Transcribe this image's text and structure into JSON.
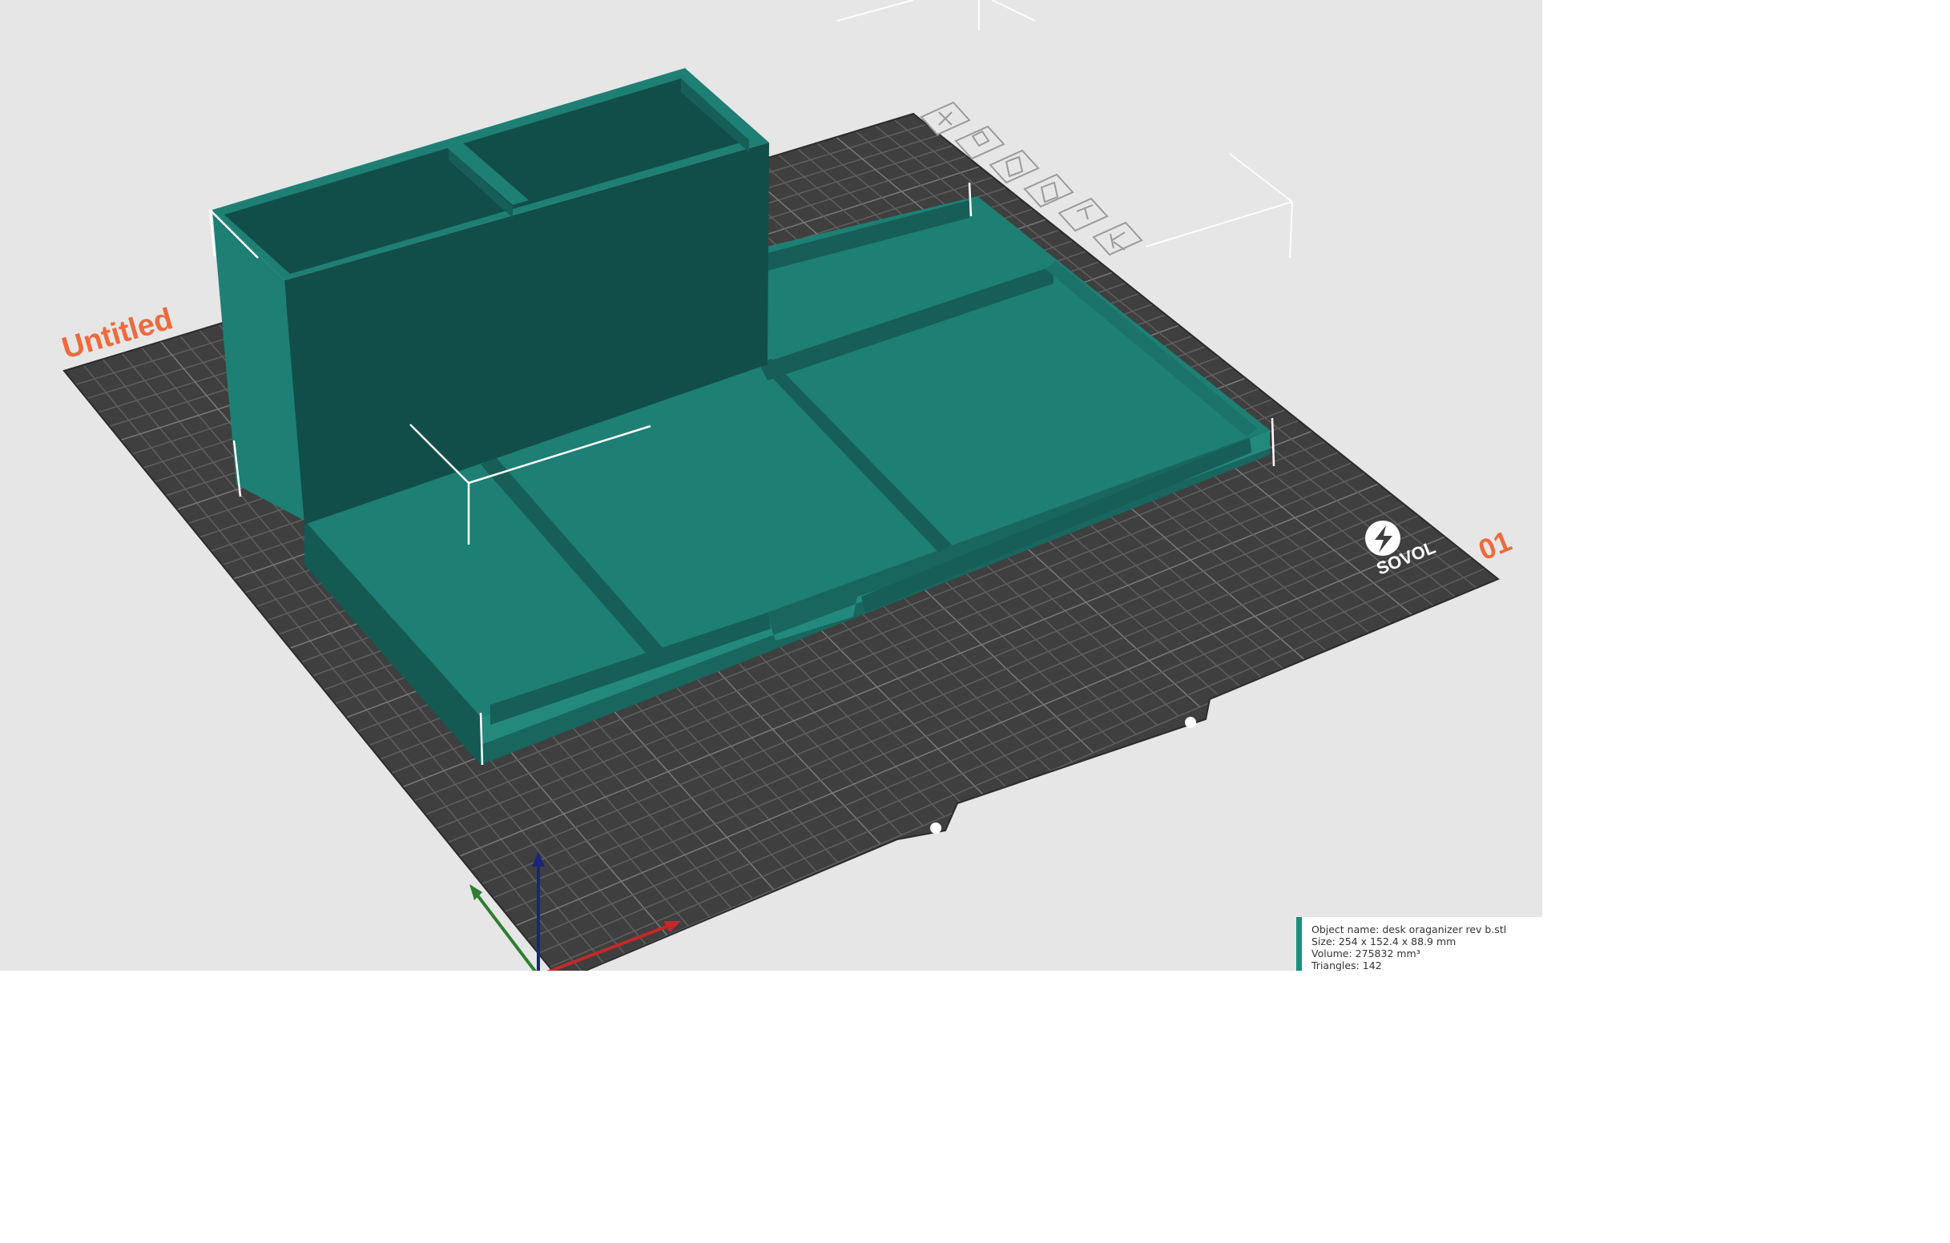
{
  "viewport": {
    "plate_label": "Untitled",
    "plate_number": "01",
    "brand": "SOVOL",
    "toolbar": [
      {
        "name": "view-iso-button",
        "icon": "iso-view-icon"
      },
      {
        "name": "view-top-button",
        "icon": "top-view-icon"
      },
      {
        "name": "view-front-button",
        "icon": "front-view-icon"
      },
      {
        "name": "view-left-button",
        "icon": "left-view-icon"
      },
      {
        "name": "view-right-button",
        "icon": "right-view-icon"
      },
      {
        "name": "view-back-button",
        "icon": "back-view-icon"
      }
    ],
    "colors": {
      "background": "#e6e6e6",
      "bed": "#3f3f3f",
      "grid": "#5f5f5f",
      "model": "#1e7f74",
      "model_dark": "#124e49",
      "accent": "#ee6a3c"
    },
    "axes": {
      "x": "#c62828",
      "y": "#2e7d32",
      "z": "#1a237e"
    }
  },
  "object_info": {
    "name_line": "Object name: desk oraganizer rev b.stl",
    "size_line": "Size: 254 x 152.4 x 88.9 mm",
    "volume_line": "Volume: 275832 mm³",
    "triangles_line": "Triangles: 142"
  }
}
